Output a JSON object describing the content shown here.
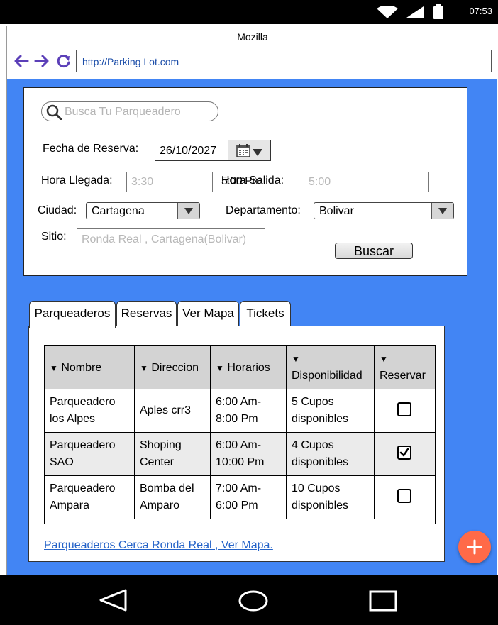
{
  "status_bar": {
    "time": "07:53",
    "icons": [
      "wifi-icon",
      "signal-icon",
      "battery-icon"
    ]
  },
  "browser": {
    "title": "Mozilla",
    "url": "http://Parking Lot.com",
    "nav_icons": [
      "back-arrow-icon",
      "forward-arrow-icon",
      "reload-icon"
    ]
  },
  "search": {
    "placeholder": "Busca Tu Parqueadero"
  },
  "form": {
    "fecha_label": "Fecha de Reserva:",
    "fecha_value": "26/10/2027",
    "hora_llegada_label": "Hora Llegada:",
    "hora_llegada_placeholder": "3:30",
    "hora_salida_label": "Hora Salida:",
    "hora_salida_overlay": "5:00 Pm",
    "hora_salida_placeholder": "5:00",
    "ciudad_label": "Ciudad:",
    "ciudad_value": "Cartagena",
    "departamento_label": "Departamento:",
    "departamento_value": "Bolivar",
    "sitio_label": "Sitio:",
    "sitio_placeholder": "Ronda Real , Cartagena(Bolivar)",
    "buscar_label": "Buscar"
  },
  "tabs": [
    {
      "label": "Parqueaderos",
      "active": true
    },
    {
      "label": "Reservas",
      "active": false
    },
    {
      "label": "Ver Mapa",
      "active": false
    },
    {
      "label": "Tickets",
      "active": false
    }
  ],
  "table": {
    "sort_glyph": "▼",
    "headers": [
      "Nombre",
      "Direccion",
      "Horarios",
      "Disponibilidad",
      "Reservar"
    ],
    "rows": [
      {
        "nombre": [
          "Parqueadero",
          "los Alpes"
        ],
        "direccion": [
          "Aples crr3"
        ],
        "horarios": [
          "6:00 Am-",
          "8:00 Pm"
        ],
        "disponibilidad": [
          "5 Cupos",
          "disponibles"
        ],
        "reservar": false
      },
      {
        "nombre": [
          "Parqueadero",
          "SAO"
        ],
        "direccion": [
          "Shoping",
          "Center"
        ],
        "horarios": [
          "6:00 Am-",
          "10:00 Pm"
        ],
        "disponibilidad": [
          "4 Cupos",
          "disponibles"
        ],
        "reservar": true
      },
      {
        "nombre": [
          "Parqueadero",
          "Ampara"
        ],
        "direccion": [
          "Bomba del",
          "Amparo"
        ],
        "horarios": [
          "7:00 Am-",
          "6:00 Pm"
        ],
        "disponibilidad": [
          "10 Cupos",
          "disponibles"
        ],
        "reservar": false
      }
    ]
  },
  "link_text": "Parqueaderos Cerca Ronda Real , Ver Mapa.",
  "fab_label": "+",
  "colors": {
    "viewport_bg": "#4285f4",
    "fab": "#ff6a48",
    "nav_icons": "#5b3fb8",
    "link": "#2563c8"
  },
  "navbar_icons": [
    "back-triangle-icon",
    "home-circle-icon",
    "recents-square-icon"
  ]
}
